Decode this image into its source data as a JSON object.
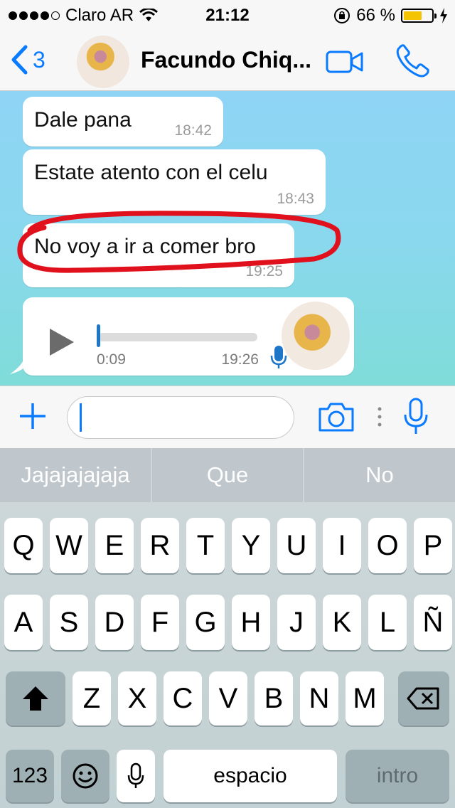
{
  "status_bar": {
    "carrier": "Claro AR",
    "time": "21:12",
    "battery_percent": "66 %",
    "battery_level": 0.66,
    "battery_color": "#f5c400"
  },
  "nav": {
    "back_count": "3",
    "contact_name": "Facundo Chiq...",
    "accent_color": "#0a7bff",
    "icons": [
      "chevron-left-icon",
      "video-call-icon",
      "phone-icon"
    ]
  },
  "messages": [
    {
      "text": "Dale pana",
      "time": "18:42"
    },
    {
      "text": "Estate atento con el celu",
      "time": "18:43"
    },
    {
      "text": "No voy a ir a comer bro",
      "time": "19:25",
      "circled": true
    }
  ],
  "voice_message": {
    "duration": "0:09",
    "time": "19:26",
    "progress": 0.0,
    "icons": [
      "play-icon",
      "microphone-icon"
    ]
  },
  "composer": {
    "value": "",
    "placeholder": "",
    "icons": [
      "plus-icon",
      "camera-icon",
      "more-icon",
      "microphone-icon"
    ]
  },
  "keyboard": {
    "suggestions": [
      "Jajajajajaja",
      "Que",
      "No"
    ],
    "row1": [
      "Q",
      "W",
      "E",
      "R",
      "T",
      "Y",
      "U",
      "I",
      "O",
      "P"
    ],
    "row2": [
      "A",
      "S",
      "D",
      "F",
      "G",
      "H",
      "J",
      "K",
      "L",
      "Ñ"
    ],
    "row3": [
      "Z",
      "X",
      "C",
      "V",
      "B",
      "N",
      "M"
    ],
    "numbers_key": "123",
    "space_key": "espacio",
    "return_key": "intro",
    "icons": [
      "shift-icon",
      "backspace-icon",
      "emoji-icon",
      "dictation-icon"
    ]
  }
}
